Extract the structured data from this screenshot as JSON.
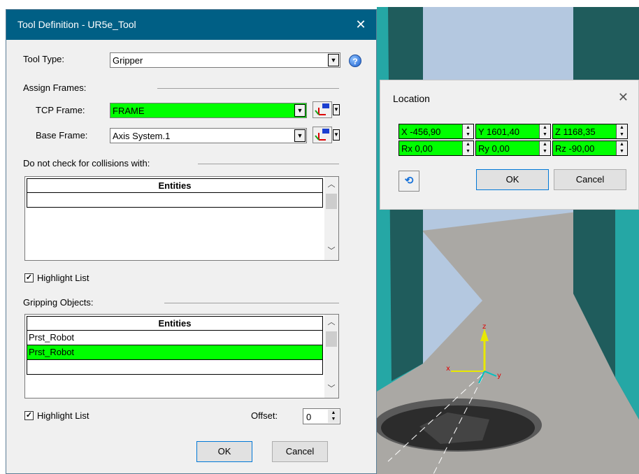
{
  "tool_dialog": {
    "title": "Tool Definition - UR5e_Tool",
    "close_glyph": "✕",
    "tool_type_label": "Tool Type:",
    "tool_type_value": "Gripper",
    "help_glyph": "?",
    "assign_frames_label": "Assign Frames:",
    "tcp_frame_label": "TCP Frame:",
    "tcp_frame_value": "FRAME",
    "base_frame_label": "Base Frame:",
    "base_frame_value": "Axis System.1",
    "collision_label": "Do not check for collisions with:",
    "collision_list": {
      "header": "Entities",
      "rows": [
        ""
      ]
    },
    "highlight_list_label_1": "Highlight List",
    "gripping_objects_label": "Gripping Objects:",
    "gripping_list": {
      "header": "Entities",
      "rows": [
        "Prst_Robot",
        "Prst_Robot",
        ""
      ]
    },
    "highlight_list_label_2": "Highlight List",
    "offset_label": "Offset:",
    "offset_value": "0",
    "ok_label": "OK",
    "cancel_label": "Cancel"
  },
  "location_dialog": {
    "title": "Location",
    "close_glyph": "✕",
    "fields": {
      "x": "X -456,90",
      "y": "Y 1601,40",
      "z": "Z 1168,35",
      "rx": "Rx 0,00",
      "ry": "Ry 0,00",
      "rz": "Rz -90,00"
    },
    "ok_label": "OK",
    "cancel_label": "Cancel"
  },
  "axis_labels": {
    "z": "z",
    "x": "x",
    "y": "y"
  },
  "colors": {
    "highlight_green": "#00ff00",
    "titlebar_blue": "#005f85",
    "pillar_teal": "#1f5a5a",
    "floor_gray": "#aaa8a4",
    "sky_blue": "#b4c8e0"
  },
  "icons": {
    "frame_picker": "frame-picker-icon",
    "refresh": "refresh-icon",
    "help": "help-icon"
  }
}
